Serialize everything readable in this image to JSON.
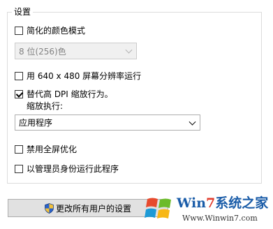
{
  "settings_group": {
    "title": "设置",
    "reduced_color_mode": {
      "label": "简化的颜色模式",
      "checked": false
    },
    "color_depth_select": {
      "value": "8 位(256)色",
      "enabled": false
    },
    "run_640x480": {
      "label": "用 640 x 480 屏幕分辨率运行",
      "checked": false
    },
    "override_high_dpi": {
      "label": "替代高 DPI 缩放行为。",
      "checked": true
    },
    "scaling_performed_by_label": "缩放执行:",
    "scaling_select": {
      "value": "应用程序"
    },
    "disable_fullscreen_opt": {
      "label": "禁用全屏优化",
      "checked": false
    },
    "run_as_admin": {
      "label": "以管理员身份运行此程序",
      "checked": false
    }
  },
  "change_all_users_button": {
    "label": "更改所有用户的设置",
    "icon": "uac-shield-icon"
  },
  "watermark": {
    "brand_prefix": "Win",
    "brand_seven": "7",
    "brand_suffix": "系统之家",
    "url": "Www.Winwin7.com"
  }
}
